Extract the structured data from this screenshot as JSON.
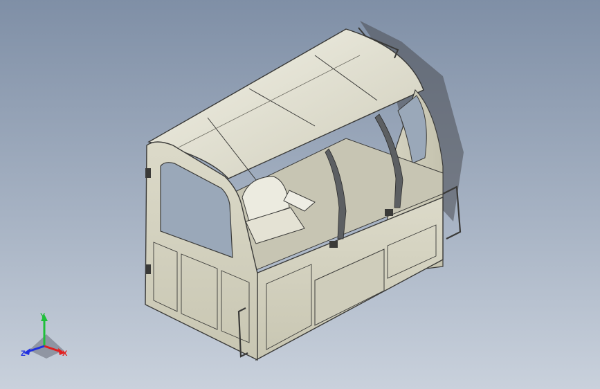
{
  "viewport": {
    "background_top": "#7f8fa6",
    "background_bottom": "#c9d1dc"
  },
  "model": {
    "body_color": "#d9d7c6",
    "edge_color": "#3a3a38",
    "glass_color": "#9aa8b9",
    "shadow_color": "#4a4d52"
  },
  "triad": {
    "x_label": "X",
    "y_label": "Y",
    "z_label": "Z",
    "x_color": "#e02020",
    "y_color": "#1fbf3a",
    "z_color": "#2030e0"
  }
}
